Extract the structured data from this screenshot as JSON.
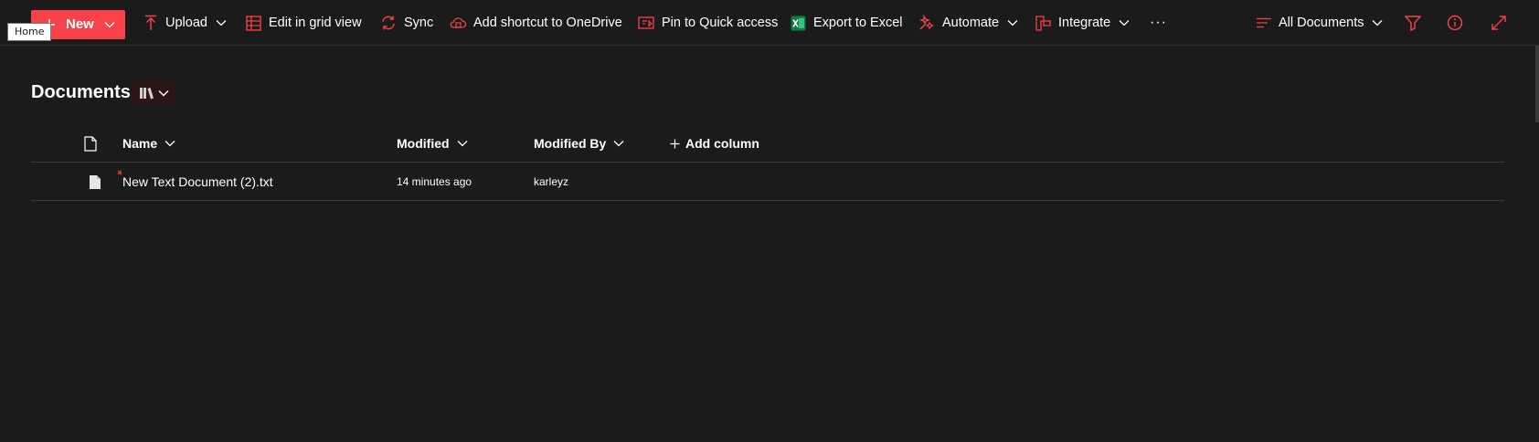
{
  "tooltip": {
    "text": "Home"
  },
  "toolbar": {
    "new_label": "New",
    "upload_label": "Upload",
    "edit_grid_label": "Edit in grid view",
    "sync_label": "Sync",
    "shortcut_label": "Add shortcut to OneDrive",
    "pin_label": "Pin to Quick access",
    "export_label": "Export to Excel",
    "automate_label": "Automate",
    "integrate_label": "Integrate",
    "more_label": "···",
    "view_label": "All Documents"
  },
  "library": {
    "title": "Documents"
  },
  "columns": {
    "name": "Name",
    "modified": "Modified",
    "modified_by": "Modified By",
    "add_column": "Add column"
  },
  "files": [
    {
      "name": "New Text Document (2).txt",
      "modified": "14 minutes ago",
      "modified_by": "karleyz"
    }
  ],
  "colors": {
    "accent": "#f7424a",
    "background": "#1b1b1b",
    "text": "#ffffff",
    "excel_green": "#107c41"
  }
}
